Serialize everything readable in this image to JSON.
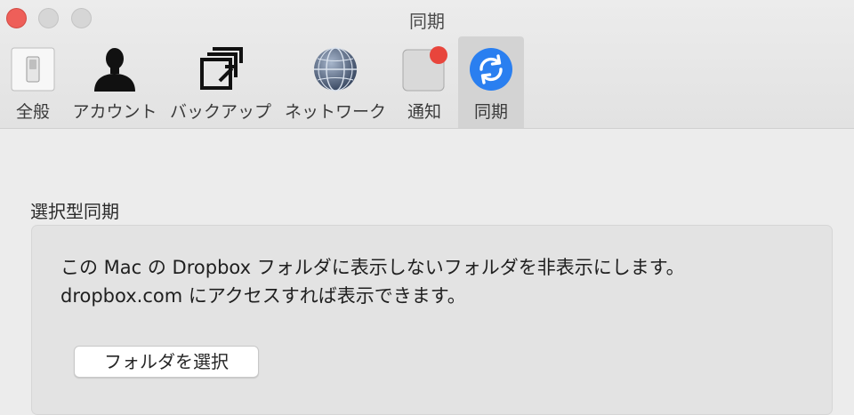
{
  "window": {
    "title": "同期"
  },
  "toolbar": {
    "tabs": [
      {
        "label": "全般",
        "icon": "switch-icon"
      },
      {
        "label": "アカウント",
        "icon": "person-icon"
      },
      {
        "label": "バックアップ",
        "icon": "backup-icon"
      },
      {
        "label": "ネットワーク",
        "icon": "globe-icon"
      },
      {
        "label": "通知",
        "icon": "notification-icon"
      },
      {
        "label": "同期",
        "icon": "sync-icon",
        "active": true
      }
    ]
  },
  "selective_sync": {
    "section_title": "選択型同期",
    "description_line1": "この Mac の Dropbox フォルダに表示しないフォルダを非表示にします。",
    "description_line2": "dropbox.com にアクセスすれば表示できます。",
    "button_label": "フォルダを選択"
  },
  "colors": {
    "close": "#ee5f59",
    "sync_blue": "#2a7ff0",
    "badge_red": "#e8453c",
    "active_tab": "#d3d3d3"
  }
}
